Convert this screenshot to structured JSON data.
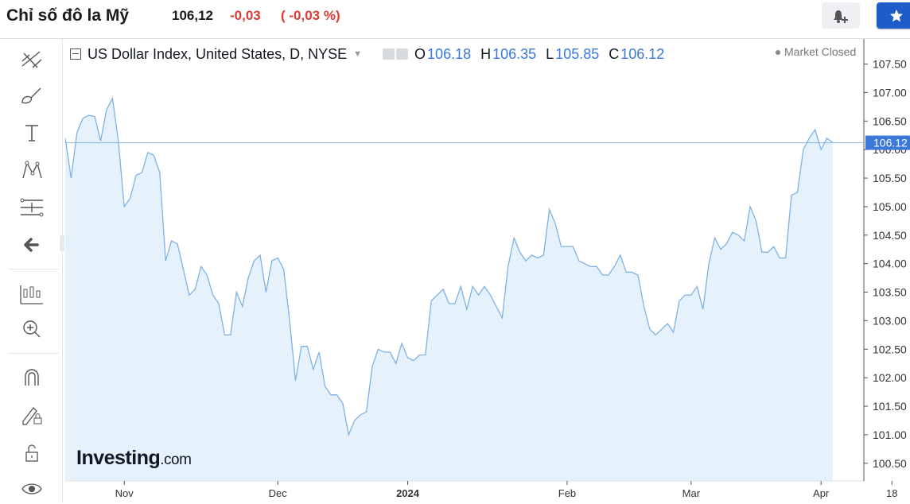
{
  "header": {
    "title": "Chỉ số đô la Mỹ",
    "price": "106,12",
    "change": "-0,03",
    "change_pct": "( -0,03 %)"
  },
  "legend": {
    "symbol": "US Dollar Index, United States, D, NYSE",
    "o_label": "O",
    "o_value": "106.18",
    "h_label": "H",
    "h_value": "106.35",
    "l_label": "L",
    "l_value": "105.85",
    "c_label": "C",
    "c_value": "106.12",
    "status": "Market Closed"
  },
  "watermark": {
    "brand": "Investing",
    "suffix": ".com"
  },
  "toolbar": [
    "crosshair-lines-icon",
    "brush-icon",
    "text-icon",
    "pattern-icon",
    "fib-tool-icon",
    "back-arrow-icon",
    "indicators-icon",
    "zoom-in-icon",
    "magnet-icon",
    "lock-drawing-icon",
    "unlock-icon",
    "eye-icon"
  ],
  "colors": {
    "line": "#7fb2e5",
    "fill": "#e5f2fb",
    "accent": "#1e5dc9",
    "negative": "#dd3b34",
    "price_tag": "#3c78d8"
  },
  "chart_data": {
    "type": "area",
    "series": [
      {
        "values": [
          106.2,
          105.5,
          106.3,
          106.55,
          106.6,
          106.58,
          106.15,
          106.7,
          106.9,
          106.15,
          105.0,
          105.15,
          105.55,
          105.6,
          105.95,
          105.9,
          105.6,
          104.05,
          104.4,
          104.35,
          103.9,
          103.45,
          103.55,
          103.95,
          103.8,
          103.45,
          103.3,
          102.75,
          102.75,
          103.5,
          103.25,
          103.75,
          104.05,
          104.15,
          103.5,
          104.05,
          104.1,
          103.9,
          103.0,
          101.95,
          102.55,
          102.55,
          102.15,
          102.45,
          101.85,
          101.7,
          101.7,
          101.55,
          101.0,
          101.25,
          101.35,
          101.4,
          102.2,
          102.5,
          102.45,
          102.45,
          102.25,
          102.6,
          102.35,
          102.3,
          102.4,
          102.4,
          103.35,
          103.45,
          103.55,
          103.3,
          103.3,
          103.6,
          103.2,
          103.6,
          103.45,
          103.6,
          103.45,
          103.25,
          103.05,
          103.95,
          104.45,
          104.2,
          104.05,
          104.15,
          104.1,
          104.15,
          104.95,
          104.7,
          104.3,
          104.3,
          104.3,
          104.05,
          104.0,
          103.95,
          103.95,
          103.8,
          103.8,
          103.95,
          104.15,
          103.85,
          103.85,
          103.8,
          103.25,
          102.85,
          102.75,
          102.85,
          102.95,
          102.8,
          103.35,
          103.45,
          103.45,
          103.6,
          103.2,
          104.0,
          104.45,
          104.25,
          104.35,
          104.55,
          104.5,
          104.4,
          105.0,
          104.75,
          104.2,
          104.2,
          104.3,
          104.1,
          104.1,
          105.2,
          105.25,
          106.0,
          106.2,
          106.35,
          106.0,
          106.2,
          106.12
        ]
      }
    ],
    "x_ticks": [
      "Nov",
      "Dec",
      "2024",
      "Feb",
      "Mar",
      "Apr",
      "18"
    ],
    "y_ticks": [
      "107.50",
      "107.00",
      "106.50",
      "106.00",
      "105.50",
      "105.00",
      "104.50",
      "104.00",
      "103.50",
      "103.00",
      "102.50",
      "102.00",
      "101.50",
      "101.00",
      "100.50"
    ],
    "ylim": [
      100.19,
      107.94
    ],
    "last_price_label": "106.12",
    "last_price": 106.12,
    "grid": false
  }
}
